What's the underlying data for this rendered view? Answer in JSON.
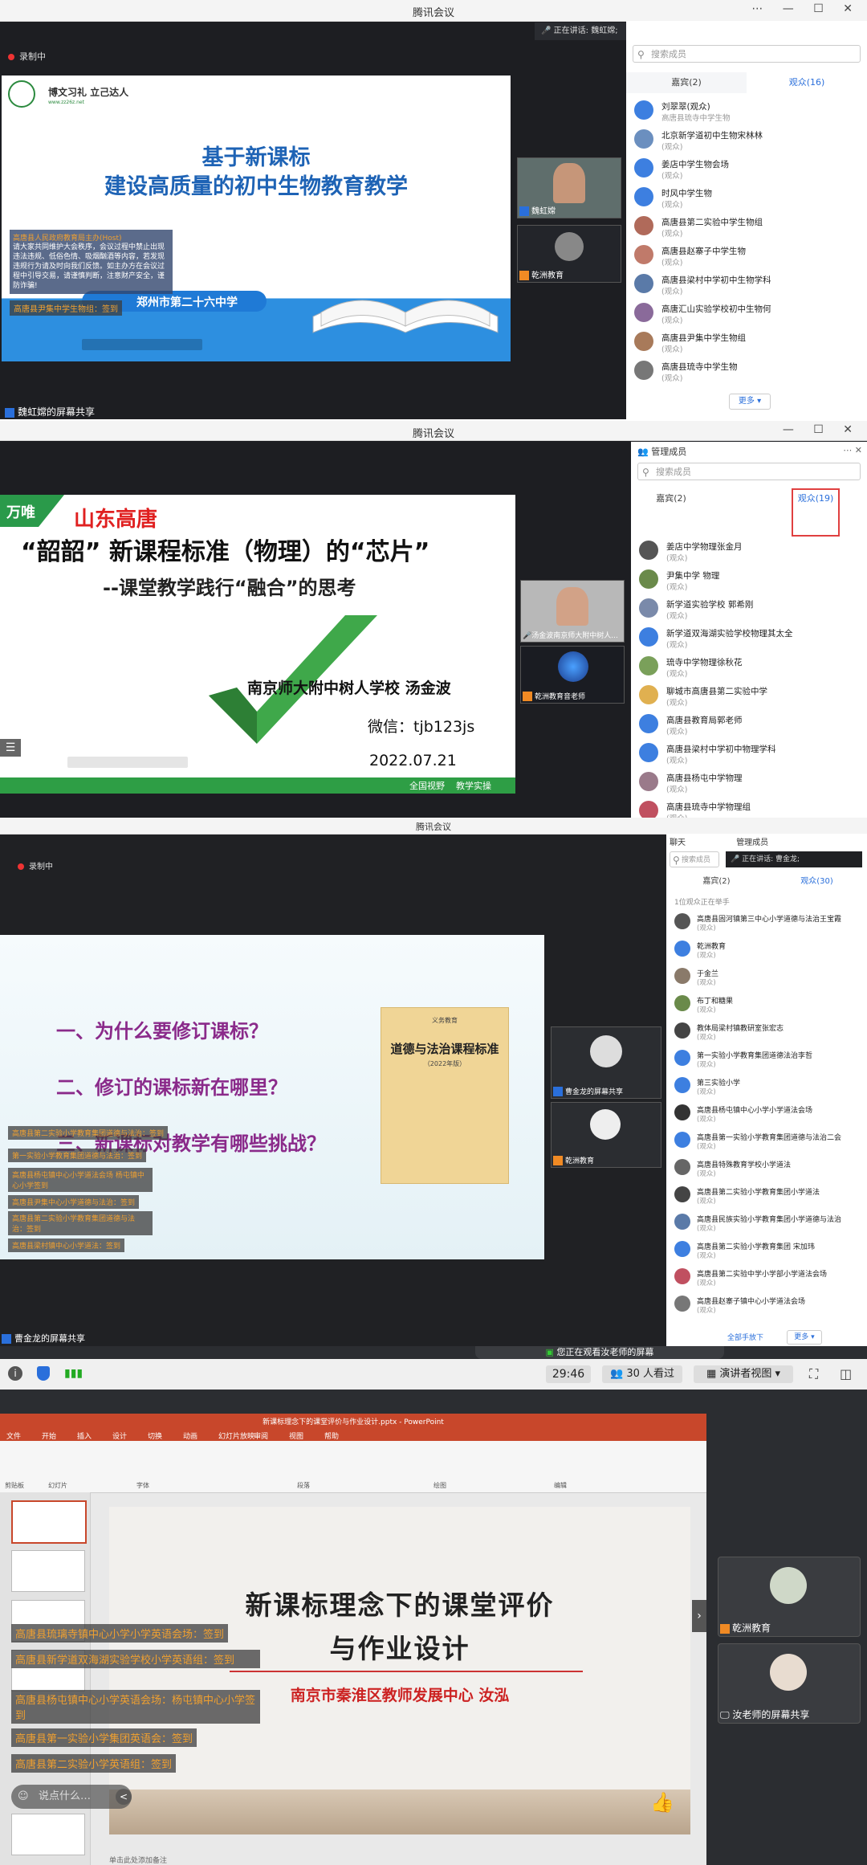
{
  "panel1": {
    "window_title": "腾讯会议",
    "recording": "录制中",
    "speaking": "正在讲话: 魏虹嫦;",
    "search_placeholder": "搜索成员",
    "tabs": [
      "嘉宾(2)",
      "观众(16)"
    ],
    "slide": {
      "motto": "博文习礼  立己达人",
      "site": "www.zz26z.net",
      "title_line1": "基于新课标",
      "title_line2": "建设高质量的初中生物教育教学",
      "school": "郑州市第二十六中学",
      "notice_title": "高唐县人民政府教育局主办(Host)",
      "notice": "请大家共同维护大会秩序，会议过程中禁止出现违法违规、低俗色情、吸烟酗酒等内容，若发现违规行为请及时向我们反馈。如主办方在会议过程中引导交易，请谨慎判断，注意财产安全，谨防诈骗!",
      "chat1": "高唐县尹集中学生物组：签到"
    },
    "members": [
      {
        "name": "刘翠翠(观众)",
        "role": "高唐县琉寺中学生物"
      },
      {
        "name": "北京新学道初中生物宋林林",
        "role": "(观众)"
      },
      {
        "name": "姜店中学生物会场",
        "role": "(观众)"
      },
      {
        "name": "时风中学生物",
        "role": "(观众)"
      },
      {
        "name": "高唐县第二实验中学生物组",
        "role": "(观众)"
      },
      {
        "name": "高唐县赵寨子中学生物",
        "role": "(观众)"
      },
      {
        "name": "高唐县梁村中学初中生物学科",
        "role": "(观众)"
      },
      {
        "name": "高唐汇山实验学校初中生物何",
        "role": "(观众)"
      },
      {
        "name": "高唐县尹集中学生物组",
        "role": "(观众)"
      },
      {
        "name": "高唐县琉寺中学生物",
        "role": "(观众)"
      }
    ],
    "more": "更多 ▾",
    "videos": [
      {
        "label": "魏虹嫦"
      },
      {
        "label": "乾洲教育"
      }
    ],
    "share_label": "魏虹嫦的屏幕共享"
  },
  "panel2": {
    "window_title": "腾讯会议",
    "manage": "管理成员",
    "search_placeholder": "搜索成员",
    "tabs": [
      "嘉宾(2)",
      "观众(19)"
    ],
    "slide": {
      "brand": "万唯",
      "region": "山东高唐",
      "title_main": "“韶韶” 新课程标准（物理）的“芯片”",
      "subtitle": "--课堂教学践行“融合”的思考",
      "author": "南京师大附中树人学校   汤金波",
      "wechat": "微信：tjb123js",
      "date": "2022.07.21",
      "footer": "全国视野    教学实操"
    },
    "members": [
      {
        "name": "姜店中学物理张金月",
        "role": "(观众)"
      },
      {
        "name": "尹集中学 物理",
        "role": "(观众)"
      },
      {
        "name": "新学道实验学校 郭希刚",
        "role": "(观众)"
      },
      {
        "name": "新学道双海湖实验学校物理其太全",
        "role": "(观众)"
      },
      {
        "name": "琉寺中学物理徐秋花",
        "role": "(观众)"
      },
      {
        "name": "聊城市高唐县第二实验中学",
        "role": "(观众)"
      },
      {
        "name": "高唐县教育局郭老师",
        "role": "(观众)"
      },
      {
        "name": "高唐县梁村中学初中物理学科",
        "role": "(观众)"
      },
      {
        "name": "高唐县杨屯中学物理",
        "role": "(观众)"
      },
      {
        "name": "高唐县琉寺中学物理组",
        "role": "(观众)"
      }
    ],
    "videos": [
      {
        "label": "汤金波南京师大附中树人..."
      },
      {
        "label": "乾洲教育音老师"
      }
    ]
  },
  "panel3": {
    "window_title": "腾讯会议",
    "recording": "录制中",
    "chat_tab": "聊天",
    "manage": "管理成员",
    "search_placeholder": "搜索成员",
    "speaking": "正在讲话: 曹金龙;",
    "tabs": [
      "嘉宾(2)",
      "观众(30)"
    ],
    "hand_note": "1位观众正在举手",
    "slide": {
      "q1": "一、为什么要修订课标？",
      "q2": "二、修订的课标新在哪里？",
      "q3": "三、新课标对教学有哪些挑战？",
      "book_top": "义务教育",
      "book_title": "道德与法治课程标准",
      "book_year": "（2022年版）"
    },
    "chats": [
      "高唐县第二实验小学教育集团道德与法治：签到",
      "第一实验小学教育集团道德与法治：签到",
      "高唐县杨屯镇中心小学道法会场 杨屯镇中心小学签到",
      "高唐县尹集中心小学道德与法治：签到",
      "高唐县第二实验小学教育集团道德与法治：签到",
      "高唐县梁村镇中心小学道法：签到"
    ],
    "members": [
      {
        "name": "高唐县固河镇第三中心小学道德与法治王宝霞",
        "role": "(观众)"
      },
      {
        "name": "乾洲教育",
        "role": "(观众)"
      },
      {
        "name": "于金兰",
        "role": "(观众)"
      },
      {
        "name": "布丁和糖果",
        "role": "(观众)"
      },
      {
        "name": "教体局梁村镇教研室张宏志",
        "role": "(观众)"
      },
      {
        "name": "第一实验小学教育集团道德法治李哲",
        "role": "(观众)"
      },
      {
        "name": "第三实验小学",
        "role": "(观众)"
      },
      {
        "name": "高唐县杨屯镇中心小学小学道法会场",
        "role": "(观众)"
      },
      {
        "name": "高唐县第一实验小学教育集团道德与法治二会",
        "role": "(观众)"
      },
      {
        "name": "高唐县特殊教育学校小学道法",
        "role": "(观众)"
      },
      {
        "name": "高唐县第二实验小学教育集团小学道法",
        "role": "(观众)"
      },
      {
        "name": "高唐县民族实验小学教育集团小学道德与法治",
        "role": "(观众)"
      },
      {
        "name": "高唐县第二实验小学教育集团 宋加玮",
        "role": "(观众)"
      },
      {
        "name": "高唐县第二实验中学小学部小学道法会场",
        "role": "(观众)"
      },
      {
        "name": "高唐县赵寨子镇中心小学道法会场",
        "role": "(观众)"
      }
    ],
    "all_hands": "全部手放下",
    "more": "更多 ▾",
    "videos": [
      {
        "label": "曹金龙的屏幕共享"
      },
      {
        "label": "乾洲教育"
      }
    ],
    "share_label": "曹金龙的屏幕共享"
  },
  "panel4": {
    "banner": "您正在观看汝老师的屏幕",
    "timer": "29:46",
    "viewers": "30 人看过",
    "view_mode": "演讲者视图",
    "ppt_title": "新课标理念下的课堂评价与作业设计.pptx - PowerPoint",
    "ribbon_tabs": [
      "文件",
      "开始",
      "插入",
      "设计",
      "切换",
      "动画",
      "幻灯片放映",
      "审阅",
      "视图",
      "帮助"
    ],
    "ribbon_groups": [
      "剪贴板",
      "幻灯片",
      "字体",
      "段落",
      "绘图",
      "编辑"
    ],
    "slide": {
      "line1": "新课标理念下的课堂评价",
      "line2": "与作业设计",
      "author": "南京市秦淮区教师发展中心   汝泓"
    },
    "chats": [
      "高唐县琉璃寺镇中心小学小学英语会场：签到",
      "高唐县新学道双海湖实验学校小学英语组：签到",
      "高唐县杨屯镇中心小学英语会场：杨屯镇中心小学签到",
      "高唐县第一实验小学集团英语会：签到",
      "高唐县第二实验小学英语组：签到"
    ],
    "chat_placeholder": "说点什么…",
    "notes_placeholder": "单击此处添加备注",
    "videos": [
      {
        "label": "乾洲教育"
      },
      {
        "label": "汝老师的屏幕共享"
      }
    ]
  }
}
